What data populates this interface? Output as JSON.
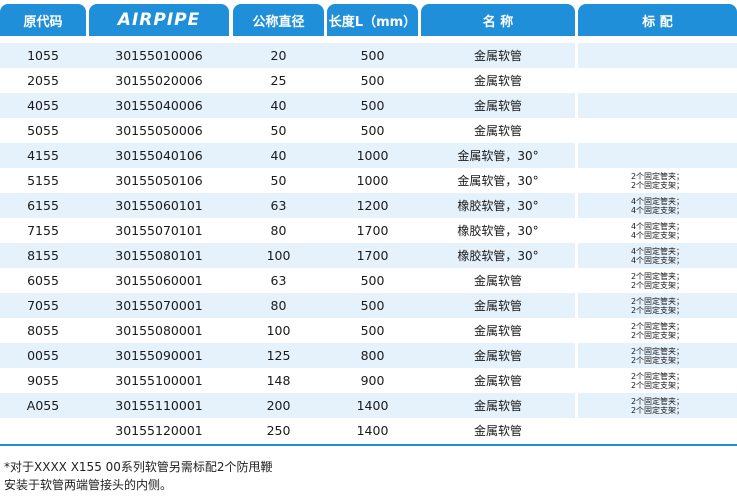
{
  "header": {
    "orig_code": "原代码",
    "brand": "AIRPIPE",
    "nominal_diameter": "公称直径",
    "length": "长度L（mm）",
    "name": "名 称",
    "standard": "标 配"
  },
  "rows": [
    {
      "code": "1055",
      "part": "30155010006",
      "dn": "20",
      "len": "500",
      "name": "金属软管",
      "note": []
    },
    {
      "code": "2055",
      "part": "30155020006",
      "dn": "25",
      "len": "500",
      "name": "金属软管",
      "note": []
    },
    {
      "code": "4055",
      "part": "30155040006",
      "dn": "40",
      "len": "500",
      "name": "金属软管",
      "note": []
    },
    {
      "code": "5055",
      "part": "30155050006",
      "dn": "50",
      "len": "500",
      "name": "金属软管",
      "note": []
    },
    {
      "code": "4155",
      "part": "30155040106",
      "dn": "40",
      "len": "1000",
      "name": "金属软管，30°",
      "note": []
    },
    {
      "code": "5155",
      "part": "30155050106",
      "dn": "50",
      "len": "1000",
      "name": "金属软管，30°",
      "note": [
        "2个固定管夹；",
        "2个固定支架；"
      ]
    },
    {
      "code": "6155",
      "part": "30155060101",
      "dn": "63",
      "len": "1200",
      "name": "橡胶软管，30°",
      "note": [
        "4个固定管夹；",
        "4个固定支架；"
      ]
    },
    {
      "code": "7155",
      "part": "30155070101",
      "dn": "80",
      "len": "1700",
      "name": "橡胶软管，30°",
      "note": [
        "4个固定管夹；",
        "4个固定支架；"
      ]
    },
    {
      "code": "8155",
      "part": "30155080101",
      "dn": "100",
      "len": "1700",
      "name": "橡胶软管，30°",
      "note": [
        "4个固定管夹；",
        "4个固定支架；"
      ]
    },
    {
      "code": "6055",
      "part": "30155060001",
      "dn": "63",
      "len": "500",
      "name": "金属软管",
      "note": [
        "2个固定管夹；",
        "2个固定支架；"
      ]
    },
    {
      "code": "7055",
      "part": "30155070001",
      "dn": "80",
      "len": "500",
      "name": "金属软管",
      "note": [
        "2个固定管夹；",
        "2个固定支架；"
      ]
    },
    {
      "code": "8055",
      "part": "30155080001",
      "dn": "100",
      "len": "500",
      "name": "金属软管",
      "note": [
        "2个固定管夹；",
        "2个固定支架；"
      ]
    },
    {
      "code": "0055",
      "part": "30155090001",
      "dn": "125",
      "len": "800",
      "name": "金属软管",
      "note": [
        "2个固定管夹；",
        "2个固定支架；"
      ]
    },
    {
      "code": "9055",
      "part": "30155100001",
      "dn": "148",
      "len": "900",
      "name": "金属软管",
      "note": [
        "2个固定管夹；",
        "2个固定支架；"
      ]
    },
    {
      "code": "A055",
      "part": "30155110001",
      "dn": "200",
      "len": "1400",
      "name": "金属软管",
      "note": [
        "2个固定管夹；",
        "2个固定支架；"
      ]
    },
    {
      "code": "",
      "part": "30155120001",
      "dn": "250",
      "len": "1400",
      "name": "金属软管",
      "note": []
    }
  ],
  "footnote": {
    "line1": "*对于XXXX X155 00系列软管另需标配2个防甩鞭",
    "line2": "安装于软管两端管接头的内侧。"
  },
  "colors": {
    "header_bg": "#1f8fd9",
    "stripe": "#e5f1fb"
  }
}
